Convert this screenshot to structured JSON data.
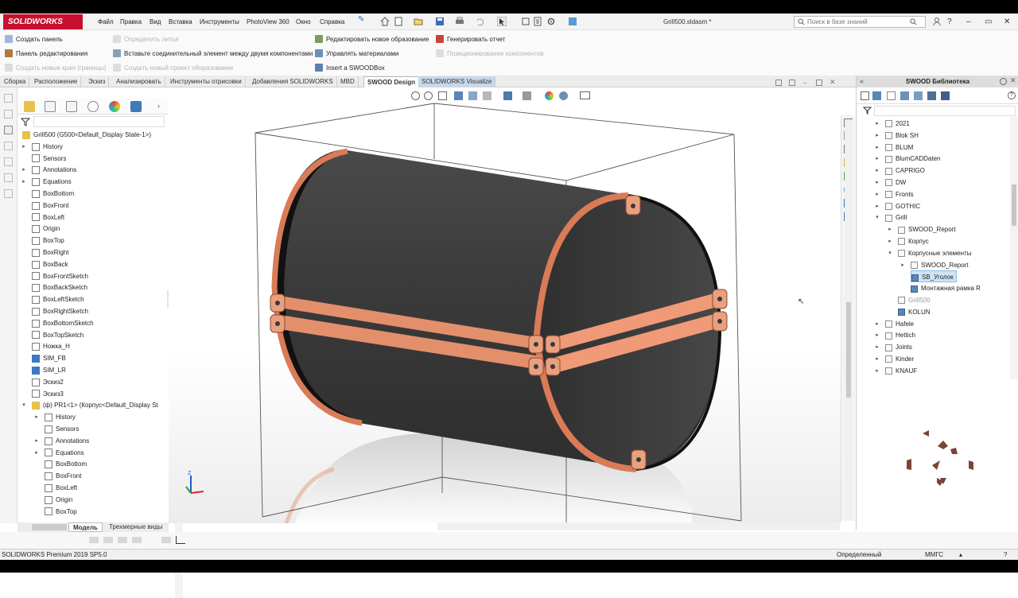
{
  "app": {
    "logo": "SOLIDWORKS",
    "document_title": "Grill500.sldasm *",
    "search_placeholder": "Поиск в базе знаний"
  },
  "menu": [
    "Файл",
    "Правка",
    "Вид",
    "Вставка",
    "Инструменты",
    "PhotoView 360",
    "Окно",
    "Справка"
  ],
  "commands": {
    "create_panel": "Создать панель",
    "edit_panel": "Панель редактирования",
    "create_new_edges": "Создать новые края (границы)",
    "define_castings": "Определить литья",
    "insert_connector": "Вставьте соединительный элемент между двумя компонентами",
    "create_new_project": "Создать новый проект оборазование",
    "edit_new_formation": "Редактировать новое образование",
    "manage_materials": "Управлять материалами",
    "insert_swoodbox": "Insert a SWOODBox",
    "generate_report": "Генерировать отчет",
    "component_positioning": "Позиционирование компонентов"
  },
  "tabs": [
    "Сборка",
    "Расположение",
    "Эскиз",
    "Анализировать",
    "Инструменты отрисовки",
    "Добавления SOLIDWORKS",
    "MBD",
    "SWOOD Design",
    "SOLIDWORKS Visualize"
  ],
  "active_tab": "SWOOD Design",
  "tree": {
    "root": "Grill500  (G500<Default_Display State-1>)",
    "items": [
      "History",
      "Sensors",
      "Annotations",
      "Equations",
      "BoxBottom",
      "BoxFront",
      "BoxLeft",
      "Origin",
      "BoxTop",
      "BoxRight",
      "BoxBack",
      "BoxFrontSketch",
      "BoxBackSketch",
      "BoxLeftSketch",
      "BoxRightSketch",
      "BoxBottomSketch",
      "BoxTopSketch",
      "Ножка_H",
      "SIM_FB",
      "SIM_LR",
      "Эскиз2",
      "Эскиз3"
    ],
    "sub_root": "(ф) PR1<1> (Корпус<Default_Display St",
    "sub_items": [
      "History",
      "Sensors",
      "Annotations",
      "Equations",
      "BoxBottom",
      "BoxFront",
      "BoxLeft",
      "Origin",
      "BoxTop"
    ]
  },
  "bottom_tabs": [
    "Модель",
    "Трехмерные виды"
  ],
  "library": {
    "title": "SWOOD Библиотека",
    "items": [
      "2021",
      "Blok SH",
      "BLUM",
      "BlumCADDaten",
      "CAPRIGO",
      "DW",
      "Fronts",
      "GOTHIC",
      "Grill",
      "SWOOD_Report",
      "Корпус",
      "Корпусные элементы",
      "SWOOD_Report",
      "SB_Уголок",
      "Монтажная рамка R",
      "Grill500",
      "KOLUN",
      "Hafele",
      "Hettich",
      "Joints",
      "Kinder",
      "KNAUF"
    ],
    "selected": "SB_Уголок"
  },
  "status": {
    "product": "SOLIDWORKS Premium 2019 SP5.0",
    "state": "Определенный",
    "units": "ММГС"
  },
  "colors": {
    "accent": "#c8102e",
    "copper": "#e2835f",
    "panel_dark": "#3f3f3f",
    "selection": "#cce4f7"
  }
}
